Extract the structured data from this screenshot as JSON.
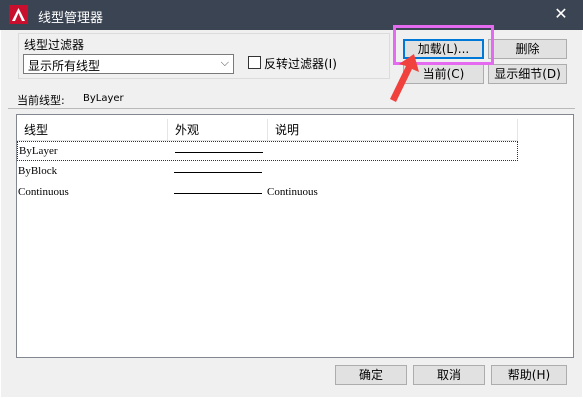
{
  "window": {
    "title": "线型管理器"
  },
  "filter": {
    "label": "线型过滤器",
    "selected": "显示所有线型",
    "invert_label": "反转过滤器(I)",
    "invert_checked": false
  },
  "buttons": {
    "load": "加载(L)...",
    "delete": "删除",
    "current": "当前(C)",
    "show_details": "显示细节(D)",
    "ok": "确定",
    "cancel": "取消",
    "help": "帮助(H)"
  },
  "current_linetype": {
    "label": "当前线型:",
    "value": "ByLayer"
  },
  "table": {
    "headers": [
      "线型",
      "外观",
      "说明"
    ],
    "rows": [
      {
        "name": "ByLayer",
        "description": ""
      },
      {
        "name": "ByBlock",
        "description": ""
      },
      {
        "name": "Continuous",
        "description": "Continuous"
      }
    ]
  },
  "colors": {
    "titlebar": "#3b4453",
    "highlight_box": "#e46af0",
    "annotation_arrow": "#f0413c",
    "default_button_border": "#0078d7"
  }
}
